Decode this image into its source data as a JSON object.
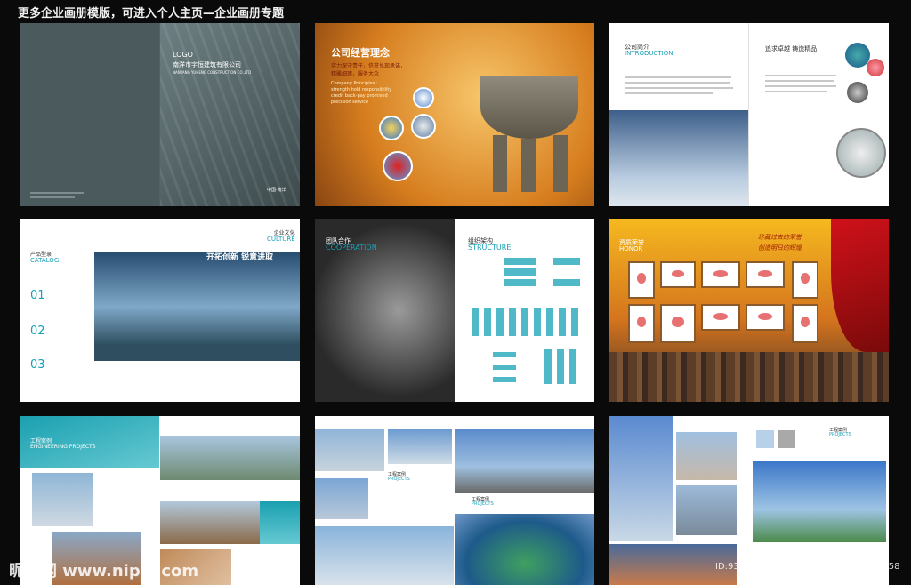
{
  "header": {
    "title": "更多企业画册模版，可进入个人主页—企业画册专题"
  },
  "panel1": {
    "logo": "LOGO",
    "company": "南洋市宇恒建筑有限公司",
    "company_en": "NANYANG YUHENG CONSTRUCTION CO.,LTD",
    "place": "中国·南洋"
  },
  "panel2": {
    "title": "公司经营理念",
    "line1": "实力深守责任，信誉兑现承诺，",
    "line2": "精雕细琢，服务大众",
    "en1": "Company Principles :",
    "en2": "strength hold responsibility",
    "en3": "credit back-pay promised",
    "en4": "precision service"
  },
  "panel3": {
    "title": "公司简介",
    "title_en": "INTRODUCTION",
    "slogan": "追求卓越 铸造精品"
  },
  "panel4": {
    "catalog": "产品型录",
    "catalog_en": "CATALOG",
    "culture": "企业文化",
    "culture_en": "CULTURE",
    "slogan": "开拓创新 锐意进取",
    "n1": "01",
    "n2": "02",
    "n3": "03"
  },
  "panel5": {
    "team": "团队合作",
    "team_en": "COOPERATION",
    "org": "组织架构",
    "org_en": "STRUCTURE"
  },
  "panel6": {
    "title": "资质荣誉",
    "title_en": "HONOR",
    "slogan1": "珍藏过去的荣誉",
    "slogan2": "创造明日的辉煌"
  },
  "panel7": {
    "title": "工程案例",
    "title_en": "ENGINEERING PROJECTS"
  },
  "panel8": {
    "title": "工程案例",
    "title_en": "PROJECTS"
  },
  "panel9": {
    "title": "工程案例",
    "title_en": "PROJECTS"
  },
  "footer": {
    "watermark": "昵图网 www.nipic.com",
    "id": "ID:9353120 NO:20140715114108657358"
  }
}
